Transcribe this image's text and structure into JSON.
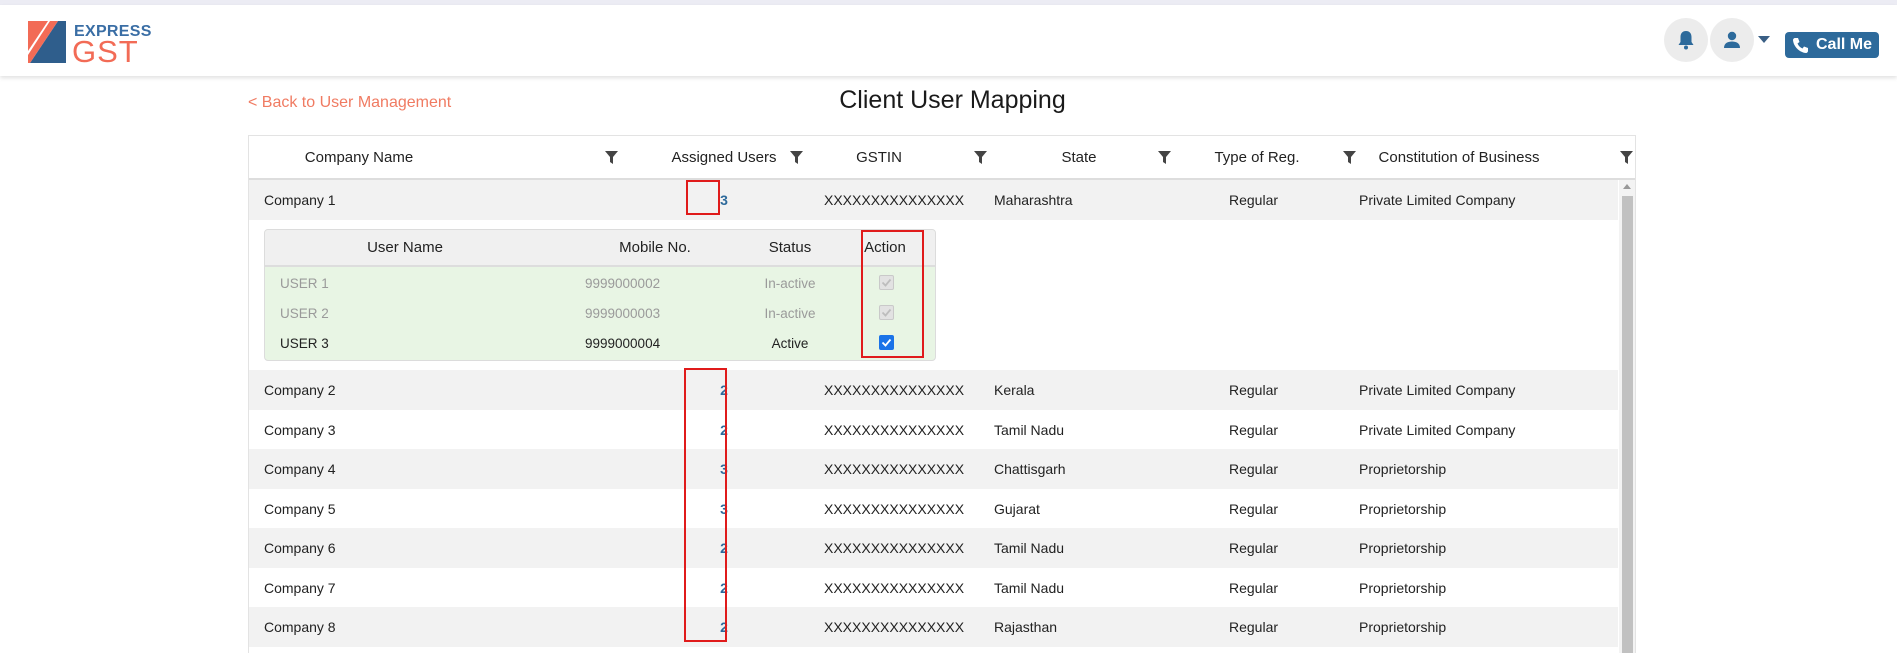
{
  "app": {
    "logo_top": "EXPRESS",
    "logo_main": "GST",
    "call_me_label": "Call Me"
  },
  "nav": {
    "back_label": "< Back to User Management",
    "page_title": "Client User Mapping"
  },
  "colors": {
    "brand_blue": "#2d6a9b",
    "brand_orange": "#f26b56",
    "highlight_red": "#e01b1b"
  },
  "table": {
    "columns": [
      "Company Name",
      "Assigned Users",
      "GSTIN",
      "State",
      "Type of Reg.",
      "Constitution of Business"
    ],
    "rows": [
      {
        "company": "Company 1",
        "assigned": "3",
        "gstin": "XXXXXXXXXXXXXXX",
        "state": "Maharashtra",
        "reg": "Regular",
        "constitution": "Private Limited Company"
      },
      {
        "company": "Company 2",
        "assigned": "2",
        "gstin": "XXXXXXXXXXXXXXX",
        "state": "Kerala",
        "reg": "Regular",
        "constitution": "Private Limited Company"
      },
      {
        "company": "Company 3",
        "assigned": "2",
        "gstin": "XXXXXXXXXXXXXXX",
        "state": "Tamil Nadu",
        "reg": "Regular",
        "constitution": "Private Limited Company"
      },
      {
        "company": "Company 4",
        "assigned": "3",
        "gstin": "XXXXXXXXXXXXXXX",
        "state": "Chattisgarh",
        "reg": "Regular",
        "constitution": "Proprietorship"
      },
      {
        "company": "Company 5",
        "assigned": "3",
        "gstin": "XXXXXXXXXXXXXXX",
        "state": "Gujarat",
        "reg": "Regular",
        "constitution": "Proprietorship"
      },
      {
        "company": "Company 6",
        "assigned": "2",
        "gstin": "XXXXXXXXXXXXXXX",
        "state": "Tamil Nadu",
        "reg": "Regular",
        "constitution": "Proprietorship"
      },
      {
        "company": "Company 7",
        "assigned": "2",
        "gstin": "XXXXXXXXXXXXXXX",
        "state": "Tamil Nadu",
        "reg": "Regular",
        "constitution": "Proprietorship"
      },
      {
        "company": "Company 8",
        "assigned": "2",
        "gstin": "XXXXXXXXXXXXXXX",
        "state": "Rajasthan",
        "reg": "Regular",
        "constitution": "Proprietorship"
      }
    ]
  },
  "subtable": {
    "columns": [
      "User Name",
      "Mobile No.",
      "Status",
      "Action"
    ],
    "rows": [
      {
        "name": "USER 1",
        "mobile": "9999000002",
        "status": "In-active",
        "checked": true,
        "disabled": true
      },
      {
        "name": "USER 2",
        "mobile": "9999000003",
        "status": "In-active",
        "checked": true,
        "disabled": true
      },
      {
        "name": "USER 3",
        "mobile": "9999000004",
        "status": "Active",
        "checked": true,
        "disabled": false
      }
    ]
  },
  "icons": [
    "bell-icon",
    "user-icon",
    "chevron-down-icon",
    "phone-icon",
    "filter-icon"
  ]
}
